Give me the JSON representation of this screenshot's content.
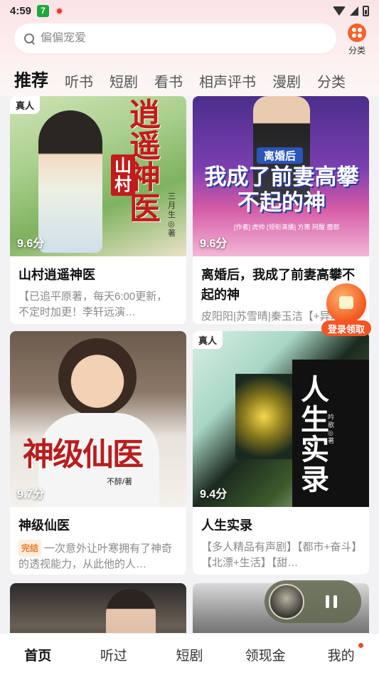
{
  "status_bar": {
    "time": "4:59",
    "app_badge": "7"
  },
  "search": {
    "placeholder": "偏偏宠爱"
  },
  "category_button": {
    "label": "分类"
  },
  "tabs": [
    "推荐",
    "听书",
    "短剧",
    "看书",
    "相声评书",
    "漫剧",
    "分类"
  ],
  "cards": [
    {
      "title": "山村逍遥神医",
      "score": "9.6分",
      "tag": "真人",
      "desc": "【已追平原著，每天6:00更新，不定时加更！李轩远演…",
      "cover_text": "逍遥神医",
      "cover_sub": "山村",
      "author": "三月生◎著"
    },
    {
      "title": "离婚后，我成了前妻高攀不起的神",
      "score": "9.6分",
      "desc": "皮阳阳|苏雪晴|秦玉洁【+异术超能+道士神医+打…",
      "cover_text": "我成了前妻高攀不起的神",
      "cover_sub": "离婚后",
      "credits": "[作者] 虎帅  [领衔演播] 方策 阿醒 鹿郎"
    },
    {
      "title": "神级仙医",
      "score": "9.7分",
      "badge": "完结",
      "desc": "一次意外让叶寒拥有了神奇的透视能力，从此他的人…",
      "cover_text": "神级仙医",
      "author": "不醉/著"
    },
    {
      "title": "人生实录",
      "score": "9.4分",
      "tag": "真人",
      "desc": "【多人精品有声剧】【都市+奋斗】【北漂+生活】【甜…",
      "cover_text": "人生实录",
      "author": "吟歌◎著"
    }
  ],
  "reward": {
    "label": "登录领取"
  },
  "bottom_nav": [
    "首页",
    "听过",
    "短剧",
    "领现金",
    "我的"
  ],
  "colors": {
    "accent": "#f45525",
    "background": "#f2f2f4"
  }
}
